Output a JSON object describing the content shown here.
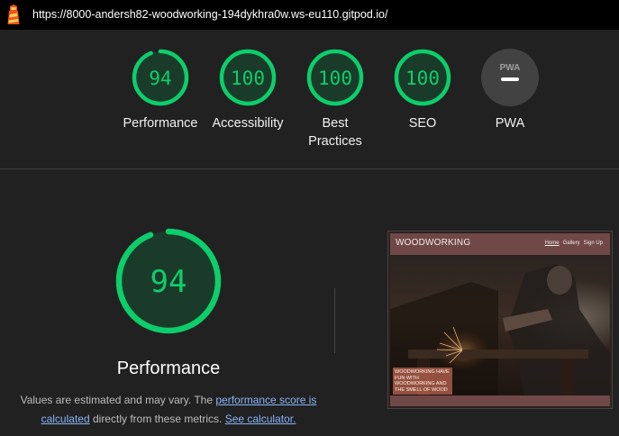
{
  "topbar": {
    "url": "https://8000-andersh82-woodworking-194dykhra0w.ws-eu110.gitpod.io/",
    "logo_icon": "lighthouse-icon"
  },
  "summary": {
    "categories": [
      {
        "label": "Performance",
        "score": "94",
        "value": 0.94,
        "color": "#0cce6b"
      },
      {
        "label": "Accessibility",
        "score": "100",
        "value": 1.0,
        "color": "#0cce6b"
      },
      {
        "label": "Best Practices",
        "score": "100",
        "value": 1.0,
        "color": "#0cce6b"
      },
      {
        "label": "SEO",
        "score": "100",
        "value": 1.0,
        "color": "#0cce6b"
      },
      {
        "label": "PWA",
        "badge_text": "PWA",
        "icon": "pwa-dash-icon",
        "color": "#424242"
      }
    ]
  },
  "performance": {
    "score": "94",
    "value": 0.94,
    "title": "Performance",
    "note_prefix": "Values are estimated and may vary. The ",
    "link_score": "performance score is calculated",
    "note_middle": " directly from these metrics. ",
    "link_calc": "See calculator."
  },
  "screenshot": {
    "brand": "WOODWORKING",
    "nav": [
      "Home",
      "Gallery",
      "Sign Up"
    ],
    "caption": "WOODWORKING HAVE FUN WITH WOODWORKING AND THE SMELL OF WOOD"
  },
  "colors": {
    "background": "#212121",
    "pass_green": "#0cce6b",
    "link": "#8ab4f8"
  }
}
